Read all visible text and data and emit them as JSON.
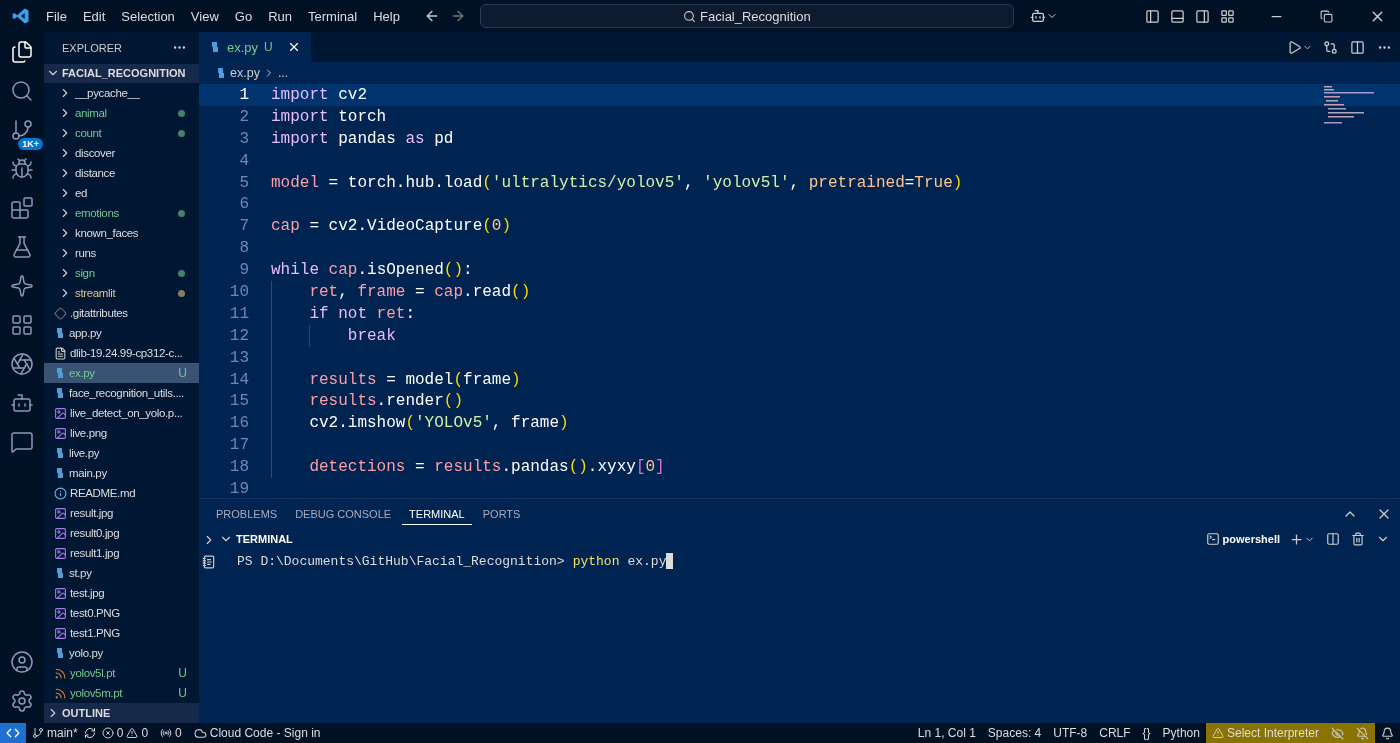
{
  "title_bar": {
    "menu": [
      "File",
      "Edit",
      "Selection",
      "View",
      "Go",
      "Run",
      "Terminal",
      "Help"
    ],
    "search": "Facial_Recognition"
  },
  "activity_bar": {
    "source_control_badge": "1K+"
  },
  "explorer": {
    "title": "EXPLORER",
    "root": {
      "label": "FACIAL_RECOGNITION",
      "expanded": true
    },
    "items": [
      {
        "label": "__pycache__",
        "kind": "folder",
        "dot": false,
        "selected": false
      },
      {
        "label": "animal",
        "kind": "folder",
        "color": "#73c991",
        "dot": true,
        "selected": false
      },
      {
        "label": "count",
        "kind": "folder",
        "color": "#73c991",
        "dot": true,
        "selected": false
      },
      {
        "label": "discover",
        "kind": "folder",
        "dot": false,
        "selected": false
      },
      {
        "label": "distance",
        "kind": "folder",
        "dot": false,
        "selected": false
      },
      {
        "label": "ed",
        "kind": "folder",
        "dot": false,
        "selected": false
      },
      {
        "label": "emotions",
        "kind": "folder",
        "color": "#73c991",
        "dot": true,
        "selected": false
      },
      {
        "label": "known_faces",
        "kind": "folder",
        "dot": false,
        "selected": false
      },
      {
        "label": "runs",
        "kind": "folder",
        "dot": false,
        "selected": false
      },
      {
        "label": "sign",
        "kind": "folder",
        "color": "#73c991",
        "dot": true,
        "selected": false
      },
      {
        "label": "streamlit",
        "kind": "folder",
        "color": "#e2c08d",
        "dot": true,
        "selected": false
      },
      {
        "label": ".gitattributes",
        "kind": "git",
        "selected": false
      },
      {
        "label": "app.py",
        "kind": "python",
        "selected": false
      },
      {
        "label": "dlib-19.24.99-cp312-c...",
        "kind": "text",
        "selected": false
      },
      {
        "label": "ex.py",
        "kind": "python",
        "color": "#73c991",
        "badge": "U",
        "selected": true
      },
      {
        "label": "face_recognition_utils....",
        "kind": "python",
        "selected": false
      },
      {
        "label": "live_detect_on_yolo.p...",
        "kind": "image",
        "selected": false
      },
      {
        "label": "live.png",
        "kind": "image",
        "selected": false
      },
      {
        "label": "live.py",
        "kind": "python",
        "selected": false
      },
      {
        "label": "main.py",
        "kind": "python",
        "selected": false
      },
      {
        "label": "README.md",
        "kind": "info",
        "selected": false
      },
      {
        "label": "result.jpg",
        "kind": "image",
        "selected": false
      },
      {
        "label": "result0.jpg",
        "kind": "image",
        "selected": false
      },
      {
        "label": "result1.jpg",
        "kind": "image",
        "selected": false
      },
      {
        "label": "st.py",
        "kind": "python",
        "selected": false
      },
      {
        "label": "test.jpg",
        "kind": "image",
        "selected": false
      },
      {
        "label": "test0.PNG",
        "kind": "image",
        "selected": false
      },
      {
        "label": "test1.PNG",
        "kind": "image",
        "selected": false
      },
      {
        "label": "yolo.py",
        "kind": "python",
        "selected": false
      },
      {
        "label": "yolov5l.pt",
        "kind": "rss",
        "color": "#73c991",
        "badge": "U",
        "selected": false
      },
      {
        "label": "yolov5m.pt",
        "kind": "rss",
        "color": "#73c991",
        "badge": "U",
        "selected": false
      }
    ],
    "outline": {
      "label": "OUTLINE",
      "expanded": false
    }
  },
  "editor": {
    "tabs": [
      {
        "label": "ex.py",
        "badge": "U",
        "color": "#73c991",
        "selected": true
      }
    ],
    "breadcrumbs": [
      "ex.py",
      "..."
    ],
    "lines": [
      {
        "number": "1",
        "current": true,
        "tokens": [
          {
            "kind": "keyword",
            "text": "import"
          },
          {
            "kind": "plain",
            "text": " cv2"
          }
        ]
      },
      {
        "number": "2",
        "current": false,
        "tokens": [
          {
            "kind": "keyword",
            "text": "import"
          },
          {
            "kind": "plain",
            "text": " torch"
          }
        ]
      },
      {
        "number": "3",
        "current": false,
        "tokens": [
          {
            "kind": "keyword",
            "text": "import"
          },
          {
            "kind": "plain",
            "text": " pandas "
          },
          {
            "kind": "keyword",
            "text": "as"
          },
          {
            "kind": "plain",
            "text": " pd"
          }
        ]
      },
      {
        "number": "4",
        "current": false
      },
      {
        "number": "5",
        "current": false,
        "tokens": [
          {
            "kind": "variable",
            "text": "model"
          },
          {
            "kind": "plain",
            "text": " = torch.hub.load"
          },
          {
            "kind": "bracket",
            "text": "("
          },
          {
            "kind": "string",
            "text": "'ultralytics/yolov5'"
          },
          {
            "kind": "plain",
            "text": ", "
          },
          {
            "kind": "string",
            "text": "'yolov5l'"
          },
          {
            "kind": "plain",
            "text": ", "
          },
          {
            "kind": "constant",
            "text": "pretrained"
          },
          {
            "kind": "plain",
            "text": "="
          },
          {
            "kind": "constant",
            "text": "True"
          },
          {
            "kind": "bracket",
            "text": ")"
          }
        ]
      },
      {
        "number": "6",
        "current": false
      },
      {
        "number": "7",
        "current": false,
        "tokens": [
          {
            "kind": "variable",
            "text": "cap"
          },
          {
            "kind": "plain",
            "text": " = cv2.VideoCapture"
          },
          {
            "kind": "bracket",
            "text": "("
          },
          {
            "kind": "constant",
            "text": "0"
          },
          {
            "kind": "bracket",
            "text": ")"
          }
        ]
      },
      {
        "number": "8",
        "current": false
      },
      {
        "number": "9",
        "current": false,
        "tokens": [
          {
            "kind": "keyword",
            "text": "while "
          },
          {
            "kind": "variable",
            "text": "cap"
          },
          {
            "kind": "plain",
            "text": ".isOpened"
          },
          {
            "kind": "bracket",
            "text": "()"
          },
          {
            "kind": "plain",
            "text": ":"
          }
        ],
        "children": [
          {
            "number": "10",
            "current": false,
            "tokens": [
              {
                "kind": "variable",
                "text": "ret"
              },
              {
                "kind": "plain",
                "text": ", "
              },
              {
                "kind": "variable",
                "text": "frame"
              },
              {
                "kind": "plain",
                "text": " = "
              },
              {
                "kind": "variable",
                "text": "cap"
              },
              {
                "kind": "plain",
                "text": ".read"
              },
              {
                "kind": "bracket",
                "text": "()"
              }
            ]
          },
          {
            "number": "11",
            "current": false,
            "tokens": [
              {
                "kind": "keyword",
                "text": "if not "
              },
              {
                "kind": "variable",
                "text": "ret"
              },
              {
                "kind": "plain",
                "text": ":"
              }
            ],
            "children": [
              {
                "number": "12",
                "current": false,
                "tokens": [
                  {
                    "kind": "keyword",
                    "text": "break"
                  }
                ]
              }
            ]
          },
          {
            "number": "13",
            "current": false
          },
          {
            "number": "14",
            "current": false,
            "tokens": [
              {
                "kind": "variable",
                "text": "results"
              },
              {
                "kind": "plain",
                "text": " = model"
              },
              {
                "kind": "bracket",
                "text": "("
              },
              {
                "kind": "plain",
                "text": "frame"
              },
              {
                "kind": "bracket",
                "text": ")"
              }
            ]
          },
          {
            "number": "15",
            "current": false,
            "tokens": [
              {
                "kind": "variable",
                "text": "results"
              },
              {
                "kind": "plain",
                "text": ".render"
              },
              {
                "kind": "bracket",
                "text": "()"
              }
            ]
          },
          {
            "number": "16",
            "current": false,
            "tokens": [
              {
                "kind": "plain",
                "text": "cv2.imshow"
              },
              {
                "kind": "bracket",
                "text": "("
              },
              {
                "kind": "string",
                "text": "'YOLOv5'"
              },
              {
                "kind": "plain",
                "text": ", frame"
              },
              {
                "kind": "bracket",
                "text": ")"
              }
            ]
          },
          {
            "number": "17",
            "current": false
          },
          {
            "number": "18",
            "current": false,
            "tokens": [
              {
                "kind": "variable",
                "text": "detections"
              },
              {
                "kind": "plain",
                "text": " = "
              },
              {
                "kind": "variable",
                "text": "results"
              },
              {
                "kind": "plain",
                "text": ".pandas"
              },
              {
                "kind": "bracket",
                "text": "()"
              },
              {
                "kind": "plain",
                "text": ".xyxy"
              },
              {
                "kind": "bracket2",
                "text": "["
              },
              {
                "kind": "constant",
                "text": "0"
              },
              {
                "kind": "bracket2",
                "text": "]"
              }
            ]
          }
        ]
      },
      {
        "number": "19",
        "current": false
      }
    ]
  },
  "panel": {
    "tabs": [
      {
        "label": "PROBLEMS",
        "selected": false
      },
      {
        "label": "DEBUG CONSOLE",
        "selected": false
      },
      {
        "label": "TERMINAL",
        "selected": true
      },
      {
        "label": "PORTS",
        "selected": false
      }
    ],
    "section": {
      "label": "TERMINAL",
      "expanded": true
    },
    "shell": "powershell",
    "prompt": "PS D:\\Documents\\GitHub\\Facial_Recognition>",
    "command": "python",
    "argument": "ex.py"
  },
  "status_bar": {
    "branch": "main*",
    "errors": "0",
    "warnings": "0",
    "ports": "0",
    "cloud": "Cloud Code - Sign in",
    "position": "Ln 1, Col 1",
    "indent": "Spaces: 4",
    "encoding": "UTF-8",
    "eol": "CRLF",
    "braces": "{}",
    "language": "Python",
    "interpreter": "Select Interpreter"
  }
}
